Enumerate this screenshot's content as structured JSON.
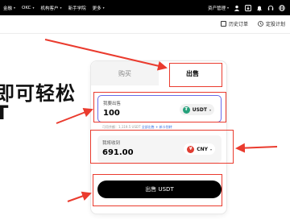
{
  "nav": {
    "items": [
      {
        "label": "金融",
        "chevron": true
      },
      {
        "label": "OKC",
        "chevron": true
      },
      {
        "label": "机构客户",
        "chevron": true
      },
      {
        "label": "新手学院",
        "chevron": false
      },
      {
        "label": "更多",
        "chevron": true
      }
    ],
    "asset_label": "资产管理"
  },
  "subbar": {
    "history_label": "历史订单",
    "plan_label": "定投计划"
  },
  "hero": {
    "line1": "即可轻松",
    "line2": "T"
  },
  "card": {
    "tab_buy": "购买",
    "tab_sell": "出售",
    "pay_label": "我要出售",
    "pay_value": "100",
    "pay_currency": "USDT",
    "hint_prefix": "可用余额：1,119.5 USDT",
    "hint_link1": "全部出售",
    "hint_link2": "+ 新卡划转",
    "recv_label": "我将收到",
    "recv_value": "691.00",
    "recv_currency": "CNY",
    "sell_button": "出售 USDT"
  },
  "colors": {
    "annotation_red": "#ea3b2e",
    "usdt_green": "#26a17b",
    "cny_red": "#e03c31",
    "focus_border": "#6a6ae8"
  }
}
